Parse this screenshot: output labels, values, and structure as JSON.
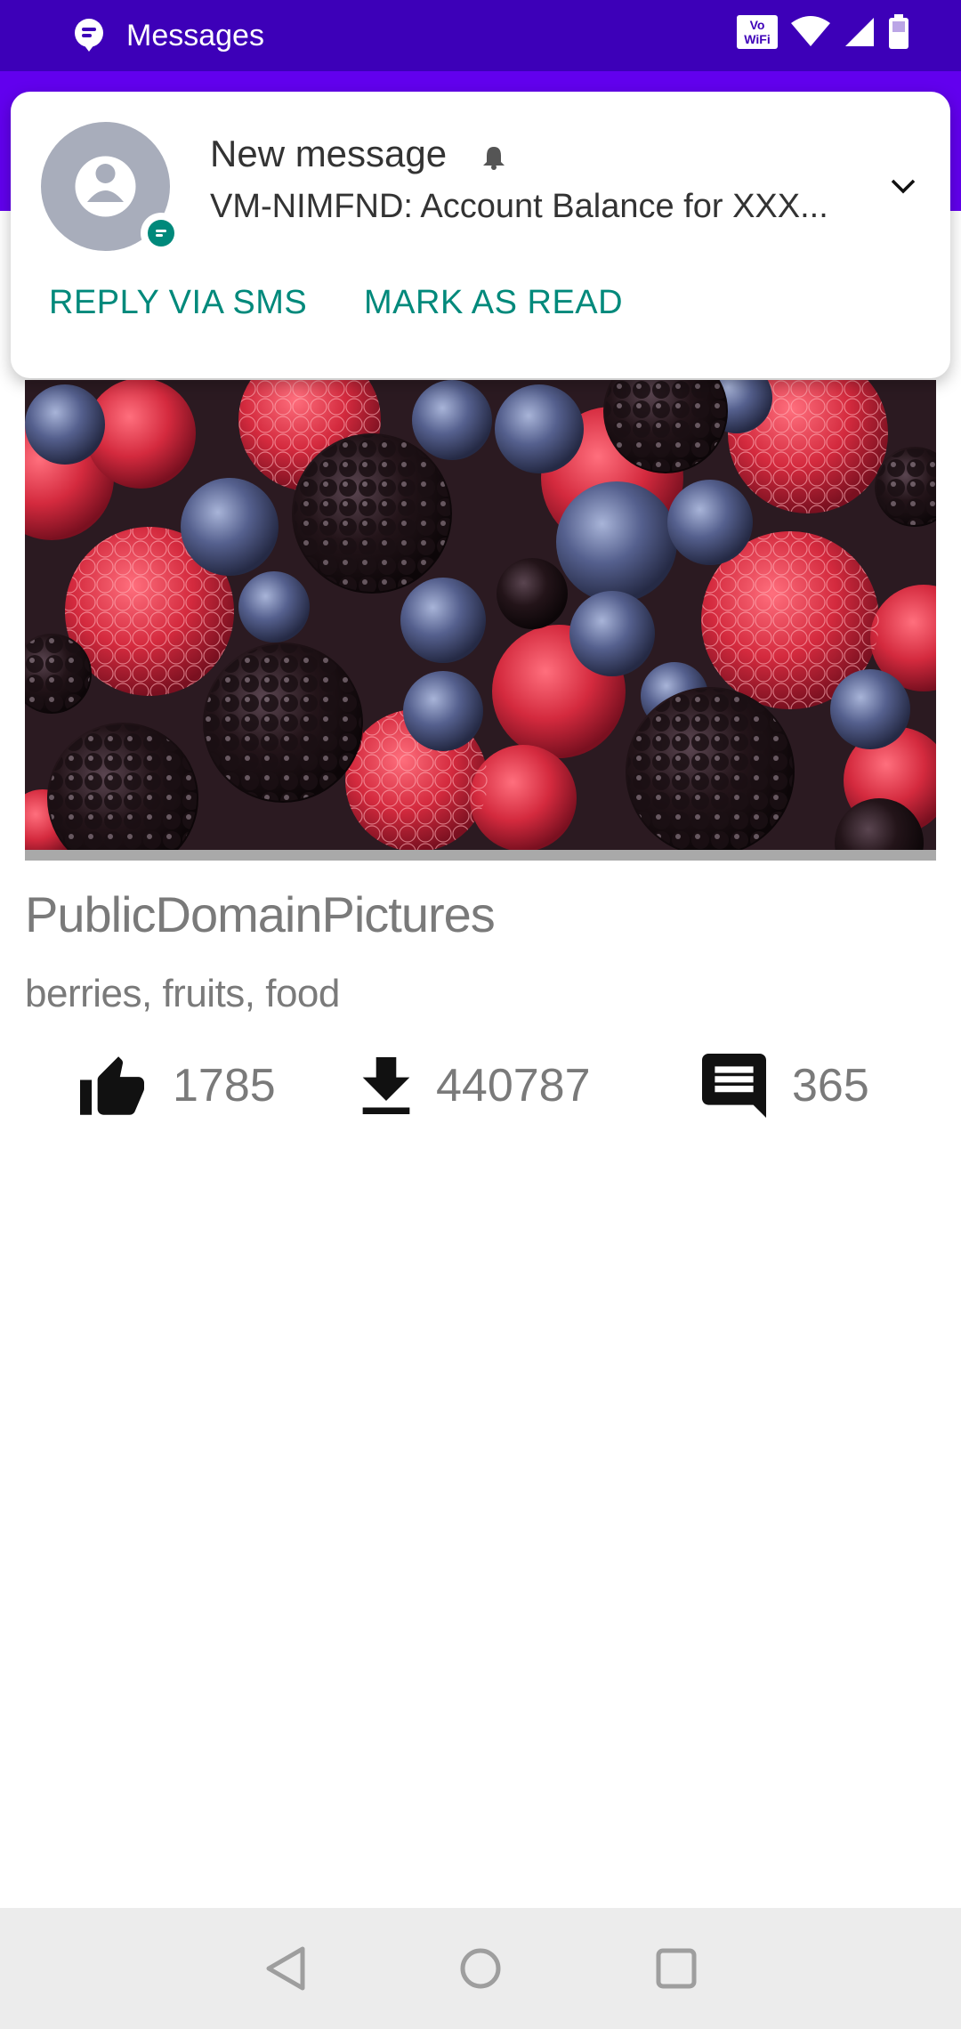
{
  "status_bar": {
    "app_label": "Messages",
    "vowifi_top": "Vo",
    "vowifi_bottom": "WiFi",
    "color": "#3d00b8"
  },
  "notification": {
    "title": "New message",
    "body": "VM-NIMFND: Account Balance for XXX...",
    "actions": [
      "REPLY VIA SMS",
      "MARK AS READ"
    ],
    "accent": "#00897b"
  },
  "content": {
    "user": "PublicDomainPictures",
    "tags": "berries, fruits, food",
    "likes": "1785",
    "downloads": "440787",
    "comments": "365"
  },
  "icons": [
    "message-icon",
    "wifi-icon",
    "signal-icon",
    "battery-icon",
    "person-icon",
    "bell-icon",
    "chevron-down-icon",
    "thumb-up-icon",
    "download-icon",
    "comment-icon",
    "back-icon",
    "home-icon",
    "recents-icon"
  ]
}
